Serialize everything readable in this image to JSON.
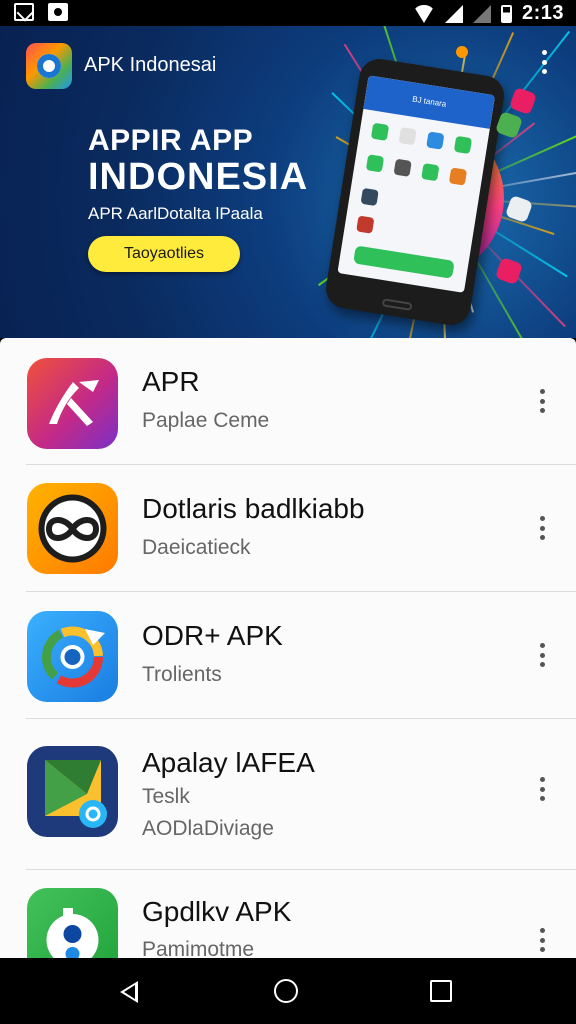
{
  "status_bar": {
    "time": "2:13",
    "icons": [
      "notification-icon",
      "notification-icon",
      "wifi-icon",
      "signal-icon",
      "signal-icon",
      "battery-icon"
    ]
  },
  "banner": {
    "app_name": "APK Indonesai",
    "headline_line1": "APPIR APP",
    "headline_line2": "INDONESIA",
    "subtitle": "APR AarlDotalta lPaala",
    "cta_label": "Taoyaotlies",
    "phone_screen_title": "BJ tanara",
    "colors": {
      "banner_bg": "#0d3d7e",
      "cta_bg": "#ffeb3b"
    }
  },
  "apps": [
    {
      "title": "APR",
      "subtitle": "Paplae Ceme",
      "icon": "phone-app-icon"
    },
    {
      "title": "Dotlaris badlkiabb",
      "subtitle": "Daeicatieck",
      "icon": "infinity-app-icon"
    },
    {
      "title": "ODR+ APK",
      "subtitle": "Trolients",
      "icon": "chrome-app-icon"
    },
    {
      "title": "Apalay lAFEA",
      "subtitle": "Teslk",
      "subtitle2": "AODlaDiviage",
      "icon": "play-store-app-icon"
    },
    {
      "title": "Gpdlkv APK",
      "subtitle": "Pamimotme",
      "icon": "green-app-icon"
    }
  ],
  "nav": {
    "icons": [
      "back-icon",
      "home-icon",
      "recents-icon"
    ]
  }
}
